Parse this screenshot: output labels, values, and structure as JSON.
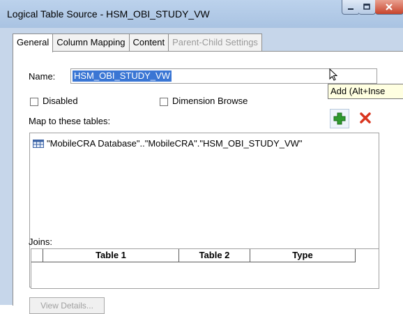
{
  "window": {
    "title": "Logical Table Source - HSM_OBI_STUDY_VW"
  },
  "tabs": [
    {
      "label": "General",
      "state": "active"
    },
    {
      "label": "Column Mapping",
      "state": "normal"
    },
    {
      "label": "Content",
      "state": "normal"
    },
    {
      "label": "Parent-Child Settings",
      "state": "disabled"
    }
  ],
  "general": {
    "name_label": "Name:",
    "name_value": "HSM_OBI_STUDY_VW",
    "disabled_label": "Disabled",
    "disabled_checked": false,
    "dimension_browse_label": "Dimension Browse",
    "dimension_browse_checked": false,
    "map_label": "Map to these tables:",
    "add_tooltip": "Add (Alt+Inse",
    "mapped_tables": [
      "\"MobileCRA Database\"..\"MobileCRA\".\"HSM_OBI_STUDY_VW\""
    ],
    "joins_label": "Joins:",
    "joins_columns": [
      "Table 1",
      "Table 2",
      "Type"
    ],
    "view_details_label": "View Details..."
  },
  "colors": {
    "titlebar": "#bcd2ec",
    "selection": "#3a76d4",
    "add_icon": "#2e9a2e",
    "delete_icon": "#d9351f",
    "tooltip_bg": "#ffffe1"
  }
}
